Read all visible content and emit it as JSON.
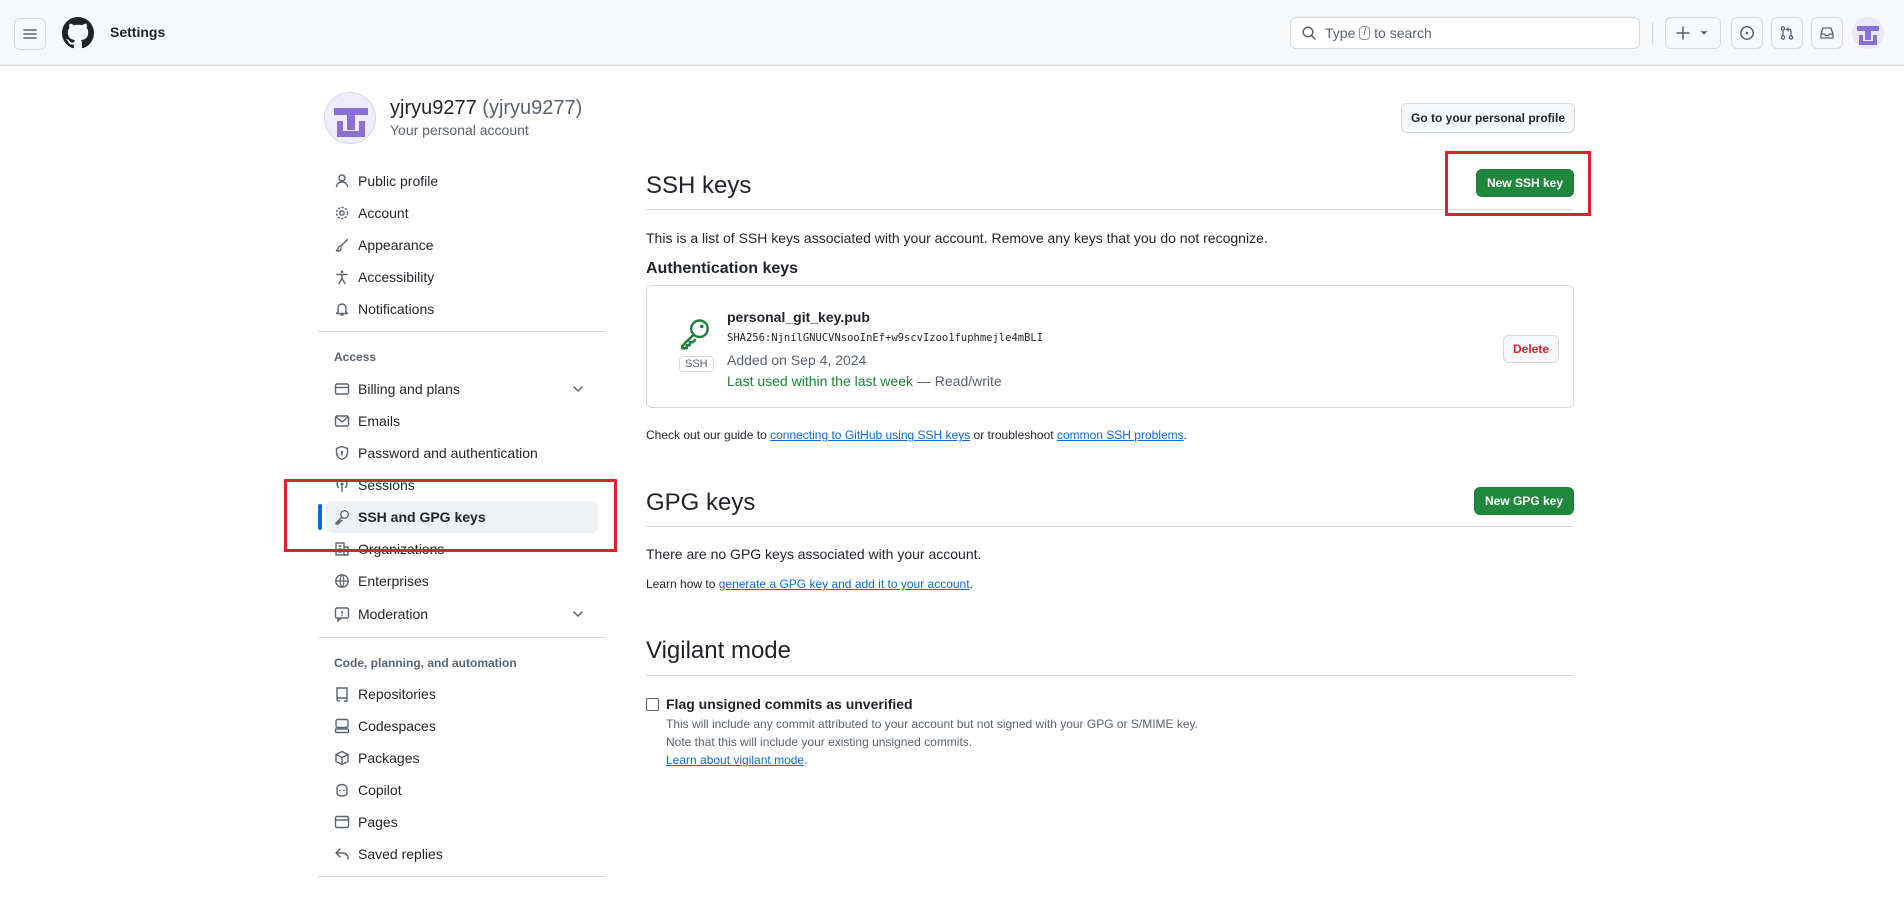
{
  "header": {
    "title": "Settings",
    "search": {
      "pre": "Type",
      "key": "/",
      "post": "to search"
    }
  },
  "profile": {
    "name": "yjryu9277",
    "handle": "(yjryu9277)",
    "subtitle": "Your personal account",
    "go_to_profile_label": "Go to your personal profile"
  },
  "sidebar": {
    "items_top": [
      {
        "label": "Public profile",
        "icon": "person-icon"
      },
      {
        "label": "Account",
        "icon": "gear-icon"
      },
      {
        "label": "Appearance",
        "icon": "paintbrush-icon"
      },
      {
        "label": "Accessibility",
        "icon": "accessibility-icon"
      },
      {
        "label": "Notifications",
        "icon": "bell-icon"
      }
    ],
    "access_heading": "Access",
    "items_access": [
      {
        "label": "Billing and plans",
        "icon": "credit-card-icon"
      },
      {
        "label": "Emails",
        "icon": "mail-icon"
      },
      {
        "label": "Password and authentication",
        "icon": "shield-lock-icon"
      },
      {
        "label": "Sessions",
        "icon": "broadcast-icon"
      },
      {
        "label": "SSH and GPG keys",
        "icon": "key-icon",
        "active": true
      },
      {
        "label": "Organizations",
        "icon": "organization-icon"
      },
      {
        "label": "Enterprises",
        "icon": "globe-icon"
      },
      {
        "label": "Moderation",
        "icon": "report-icon"
      }
    ],
    "code_heading": "Code, planning, and automation",
    "items_code": [
      {
        "label": "Repositories",
        "icon": "repo-icon"
      },
      {
        "label": "Codespaces",
        "icon": "codespaces-icon"
      },
      {
        "label": "Packages",
        "icon": "package-icon"
      },
      {
        "label": "Copilot",
        "icon": "copilot-icon"
      },
      {
        "label": "Pages",
        "icon": "browser-icon"
      },
      {
        "label": "Saved replies",
        "icon": "reply-icon"
      }
    ]
  },
  "ssh": {
    "title": "SSH keys",
    "new_label": "New SSH key",
    "description": "This is a list of SSH keys associated with your account. Remove any keys that you do not recognize.",
    "auth_heading": "Authentication keys",
    "key": {
      "badge": "SSH",
      "title": "personal_git_key.pub",
      "fingerprint": "SHA256:NjnilGNUCVNsooInEf+w9scvIzoo1fuphmejle4mBLI",
      "added": "Added on Sep 4, 2024",
      "last_used": "Last used within the last week",
      "access": "— Read/write",
      "delete_label": "Delete"
    },
    "guide": {
      "pre": "Check out our guide to",
      "link1": "connecting to GitHub using SSH keys",
      "mid": "or troubleshoot",
      "link2": "common SSH problems",
      "post": "."
    }
  },
  "gpg": {
    "title": "GPG keys",
    "new_label": "New GPG key",
    "empty": "There are no GPG keys associated with your account.",
    "learn_pre": "Learn how to",
    "learn_link": "generate a GPG key and add it to your account",
    "learn_post": "."
  },
  "vigilant": {
    "title": "Vigilant mode",
    "checkbox_label": "Flag unsigned commits as unverified",
    "note1": "This will include any commit attributed to your account but not signed with your GPG or S/MIME key.",
    "note2": "Note that this will include your existing unsigned commits.",
    "link": "Learn about vigilant mode",
    "link_post": "."
  },
  "colors": {
    "accent_green": "#1f883d",
    "link_blue": "#0969da",
    "danger_red": "#d1242f",
    "highlight_red": "#e0222c"
  }
}
